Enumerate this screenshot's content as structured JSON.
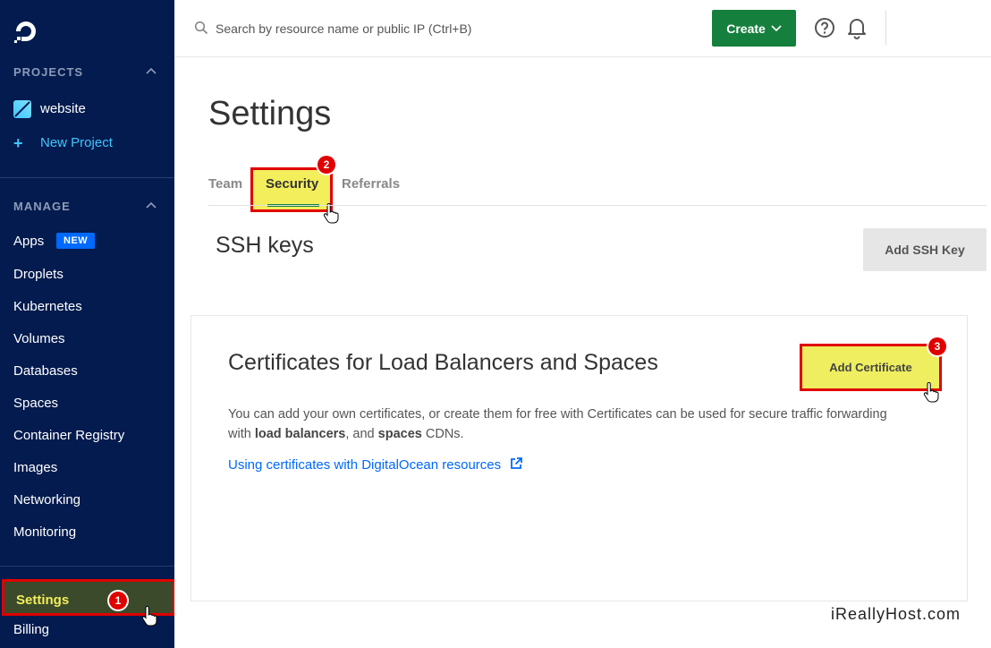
{
  "sidebar": {
    "projects_header": "PROJECTS",
    "project_name": "website",
    "new_project": "New Project",
    "manage_header": "MANAGE",
    "apps_badge": "NEW",
    "items": [
      "Apps",
      "Droplets",
      "Kubernetes",
      "Volumes",
      "Databases",
      "Spaces",
      "Container Registry",
      "Images",
      "Networking",
      "Monitoring"
    ],
    "settings": "Settings",
    "billing": "Billing"
  },
  "topbar": {
    "search_placeholder": "Search by resource name or public IP (Ctrl+B)",
    "create_label": "Create"
  },
  "page": {
    "title": "Settings",
    "tabs": [
      "Team",
      "Security",
      "Referrals"
    ]
  },
  "ssh": {
    "title": "SSH keys",
    "add_button": "Add SSH Key"
  },
  "certificates": {
    "title": "Certificates for Load Balancers and Spaces",
    "add_button": "Add Certificate",
    "desc_part1": "You can add your own certificates, or create them for free with  Certificates can be used for secure traffic forwarding with ",
    "desc_bold1": "load balancers",
    "desc_part2": ", and ",
    "desc_bold2": "spaces",
    "desc_part3": " CDNs.",
    "link": "Using certificates with DigitalOcean resources"
  },
  "annotations": [
    "1",
    "2",
    "3"
  ],
  "watermark": "iReallyHost.com",
  "colors": {
    "sidebar_bg": "#031b4e",
    "accent_blue": "#0069ff",
    "create_green": "#15803d",
    "highlight_yellow": "#f3ee5c",
    "annotation_red": "#e00000"
  }
}
